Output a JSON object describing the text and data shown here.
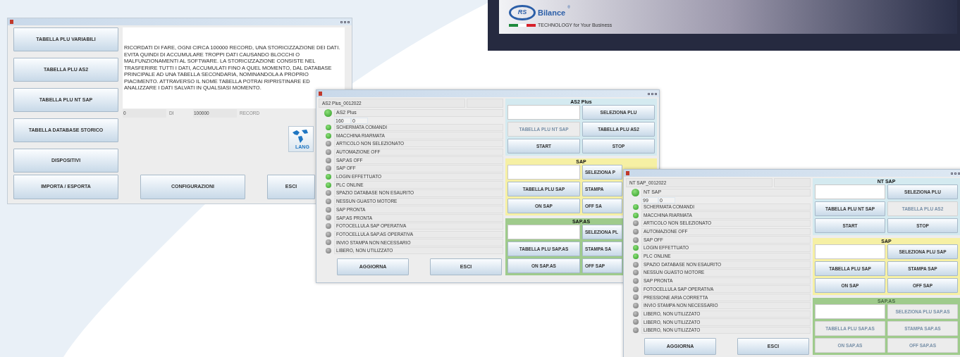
{
  "banner": {
    "logo_letters": "RS",
    "brand": "Bilance",
    "registered": "®",
    "tagline": "TECHNOLOGY for Your Business"
  },
  "main_window": {
    "menu_buttons": [
      "TABELLA PLU VARIABILI",
      "TABELLA PLU AS2",
      "TABELLA PLU NT SAP",
      "TABELLA DATABASE STORICO",
      "DISPOSITIVI"
    ],
    "notice": "RICORDATI DI FARE, OGNI CIRCA 100000 RECORD, UNA STORICIZZAZIONE DEI DATI. EVITA QUINDI DI ACCUMULARE TROPPI DATI CAUSANDO BLOCCHI O MALFUNZIONAMENTI AL SOFTWARE. LA STORICIZZAZIONE CONSISTE NEL TRASFERIRE TUTTI I DATI, ACCUMULATI FINO A QUEL MOMENTO, DAL DATABASE PRINCIPALE AD UNA TABELLA SECONDARIA, NOMINANDOLA A PROPRIO PIACIMENTO. ATTRAVERSO IL NOME TABELLA POTRAI RIPRISTINARE ED ANALIZZARE I DATI SALVATI IN QUALSIASI MOMENTO.",
    "record_count": "0",
    "of_label": "DI",
    "record_limit": "100000",
    "record_label": "RECORD",
    "language_label": "LANG",
    "bottom_buttons": [
      "IMPORTA / ESPORTA",
      "CONFIGURAZIONI",
      "ESCI"
    ]
  },
  "command_windows": [
    {
      "header": "AS2 Plus_0012022",
      "device": {
        "name": "AS2 Plus",
        "on": true,
        "counter": [
          "160",
          "0"
        ]
      },
      "statuses": [
        {
          "label": "SCHERMATA COMANDI",
          "on": true
        },
        {
          "label": "MACCHINA RIARMATA",
          "on": true
        },
        {
          "label": "ARTICOLO NON SELEZIONATO",
          "on": false
        },
        {
          "label": "AUTOMAZIONE OFF",
          "on": false
        },
        {
          "label": "SAP.AS OFF",
          "on": false
        },
        {
          "label": "SAP OFF",
          "on": false
        },
        {
          "label": "LOGIN EFFETTUATO",
          "on": true
        },
        {
          "label": "PLC ONLINE",
          "on": true
        },
        {
          "label": "SPAZIO DATABASE NON ESAURITO",
          "on": false
        },
        {
          "label": "NESSUN GUASTO MOTORE",
          "on": false
        },
        {
          "label": "SAP PRONTA",
          "on": false
        },
        {
          "label": "SAP.AS PRONTA",
          "on": false
        },
        {
          "label": "FOTOCELLULA SAP OPERATIVA",
          "on": false
        },
        {
          "label": "FOTOCELLULA SAP.AS OPERATIVA",
          "on": false
        },
        {
          "label": "INVIO STAMPA NON NECESSARIO",
          "on": false
        },
        {
          "label": "LIBERO, NON UTILIZZATO",
          "on": false
        }
      ],
      "buttons": [
        "AGGIORNA",
        "ESCI"
      ],
      "groups": [
        {
          "title": "AS2 Plus",
          "color": "#d4eaf0",
          "disabled": false,
          "buttons": [
            {
              "label": "SELEZIONA PLU",
              "disabled": false
            },
            {
              "label": "TABELLA PLU NT SAP",
              "disabled": true
            },
            {
              "label": "TABELLA PLU AS2",
              "disabled": false
            },
            {
              "label": "START",
              "disabled": false
            },
            {
              "label": "STOP",
              "disabled": false
            }
          ]
        },
        {
          "title": "SAP",
          "color": "#f6f0a4",
          "disabled": false,
          "buttons": [
            {
              "label": "SELEZIONA P",
              "disabled": false
            },
            {
              "label": "TABELLA PLU SAP",
              "disabled": false
            },
            {
              "label": "STAMPA",
              "disabled": false
            },
            {
              "label": "ON SAP",
              "disabled": false
            },
            {
              "label": "OFF SA",
              "disabled": false
            }
          ]
        },
        {
          "title": "SAP.AS",
          "color": "#9fcb8c",
          "disabled": false,
          "buttons": [
            {
              "label": "SELEZIONA PL",
              "disabled": false
            },
            {
              "label": "TABELLA PLU SAP.AS",
              "disabled": false
            },
            {
              "label": "STAMPA SA",
              "disabled": false
            },
            {
              "label": "ON SAP.AS",
              "disabled": false
            },
            {
              "label": "OFF SAP",
              "disabled": false
            }
          ]
        }
      ]
    },
    {
      "header": "NT SAP_0012022",
      "device": {
        "name": "NT SAP",
        "on": true,
        "counter": [
          "99",
          "0"
        ]
      },
      "statuses": [
        {
          "label": "SCHERMATA COMANDI",
          "on": true
        },
        {
          "label": "MACCHINA RIARMATA",
          "on": true
        },
        {
          "label": "ARTICOLO NON SELEZIONATO",
          "on": false
        },
        {
          "label": "AUTOMAZIONE OFF",
          "on": false
        },
        {
          "label": "SAP OFF",
          "on": false
        },
        {
          "label": "LOGIN EFFETTUATO",
          "on": true
        },
        {
          "label": "PLC ONLINE",
          "on": true
        },
        {
          "label": "SPAZIO DATABASE NON ESAURITO",
          "on": false
        },
        {
          "label": "NESSUN GUASTO MOTORE",
          "on": false
        },
        {
          "label": "SAP PRONTA",
          "on": false
        },
        {
          "label": "FOTOCELLULA SAP OPERATIVA",
          "on": false
        },
        {
          "label": "PRESSIONE ARIA CORRETTA",
          "on": false
        },
        {
          "label": "INVIO STAMPA NON NECESSARIO",
          "on": false
        },
        {
          "label": "LIBERO, NON UTILIZZATO",
          "on": false
        },
        {
          "label": "LIBERO, NON UTILIZZATO",
          "on": false
        },
        {
          "label": "LIBERO, NON UTILIZZATO",
          "on": false
        }
      ],
      "buttons": [
        "AGGIORNA",
        "ESCI"
      ],
      "groups": [
        {
          "title": "NT SAP",
          "color": "#d4eaf0",
          "disabled": false,
          "buttons": [
            {
              "label": "SELEZIONA PLU",
              "disabled": false
            },
            {
              "label": "TABELLA PLU NT SAP",
              "disabled": false
            },
            {
              "label": "TABELLA PLU AS2",
              "disabled": true
            },
            {
              "label": "START",
              "disabled": false
            },
            {
              "label": "STOP",
              "disabled": false
            }
          ]
        },
        {
          "title": "SAP",
          "color": "#f6f0a4",
          "disabled": false,
          "buttons": [
            {
              "label": "SELEZIONA PLU SAP",
              "disabled": false
            },
            {
              "label": "TABELLA PLU SAP",
              "disabled": false
            },
            {
              "label": "STAMPA SAP",
              "disabled": false
            },
            {
              "label": "ON SAP",
              "disabled": false
            },
            {
              "label": "OFF SAP",
              "disabled": false
            }
          ]
        },
        {
          "title": "SAP.AS",
          "color": "#9fcb8c",
          "disabled": true,
          "buttons": [
            {
              "label": "SELEZIONA PLU SAP.AS",
              "disabled": true
            },
            {
              "label": "TABELLA PLU SAP.AS",
              "disabled": true
            },
            {
              "label": "STAMPA SAP.AS",
              "disabled": true
            },
            {
              "label": "ON SAP.AS",
              "disabled": true
            },
            {
              "label": "OFF SAP.AS",
              "disabled": true
            }
          ]
        }
      ]
    }
  ]
}
